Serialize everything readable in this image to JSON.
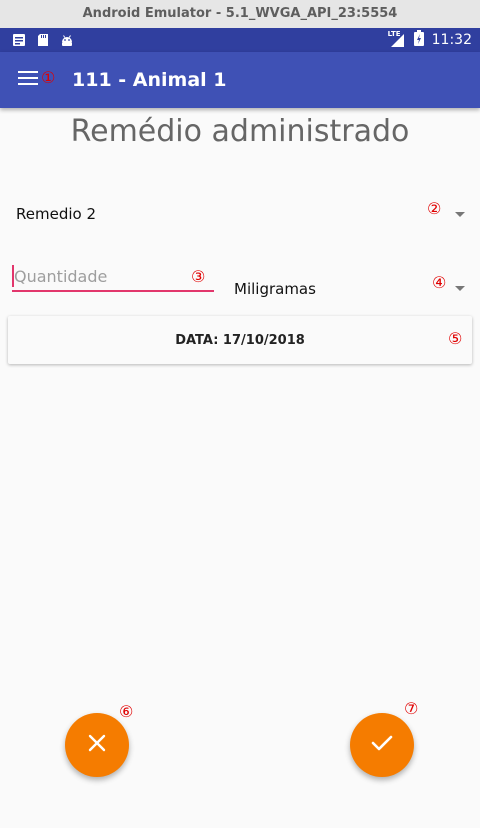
{
  "emulator": {
    "title": "Android Emulator - 5.1_WVGA_API_23:5554"
  },
  "status_bar": {
    "time": "11:32",
    "network_label": "LTE",
    "left_icons": [
      "notification-icon",
      "sd-card-icon",
      "android-icon"
    ]
  },
  "app_bar": {
    "title": "111 - Animal 1",
    "menu_icon": "menu-icon",
    "color": "#3f51b5",
    "status_color": "#303f9f"
  },
  "page": {
    "heading": "Remédio administrado"
  },
  "medicine_select": {
    "value": "Remedio 2"
  },
  "quantity": {
    "placeholder": "Quantidade",
    "value": ""
  },
  "unit_select": {
    "value": "Miligramas"
  },
  "date_button": {
    "label": "DATA: 17/10/2018"
  },
  "actions": {
    "cancel_icon": "close-icon",
    "confirm_icon": "check-icon",
    "fab_color": "#f57c00"
  },
  "markers": [
    "①",
    "②",
    "③",
    "④",
    "⑤",
    "⑥",
    "⑦"
  ]
}
